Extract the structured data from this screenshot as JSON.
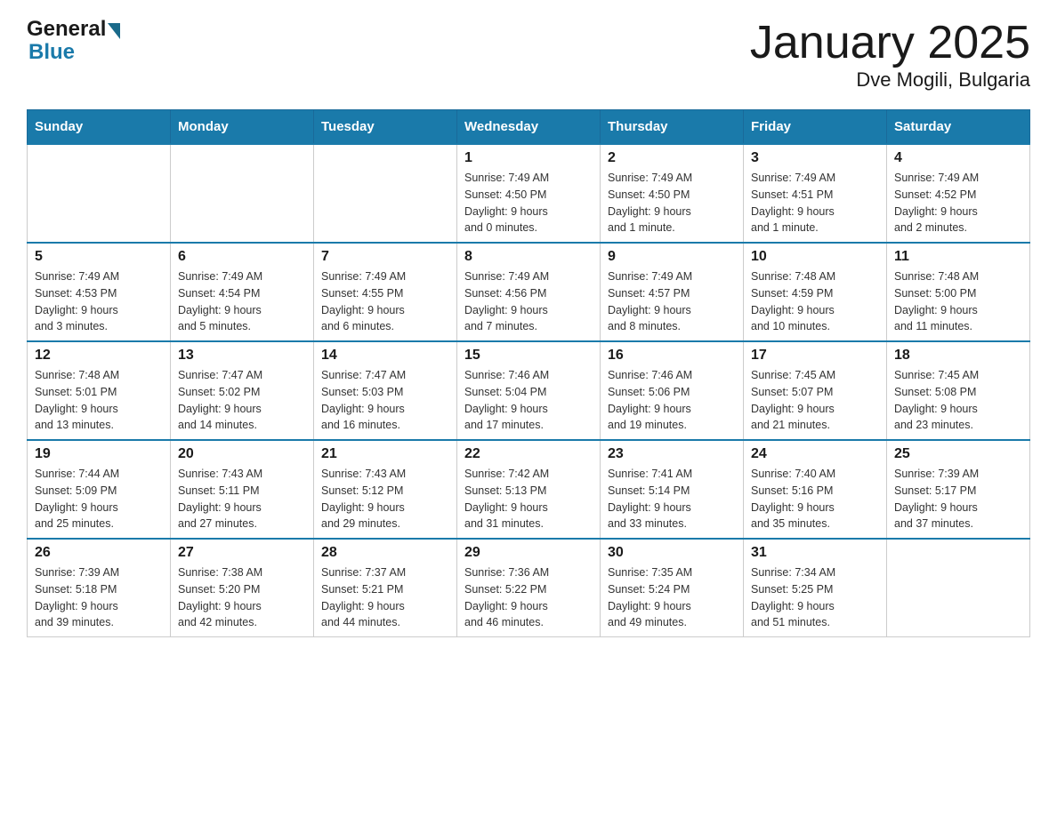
{
  "header": {
    "logo_general": "General",
    "logo_blue": "Blue",
    "main_title": "January 2025",
    "subtitle": "Dve Mogili, Bulgaria"
  },
  "calendar": {
    "days_of_week": [
      "Sunday",
      "Monday",
      "Tuesday",
      "Wednesday",
      "Thursday",
      "Friday",
      "Saturday"
    ],
    "weeks": [
      [
        {
          "day": "",
          "info": ""
        },
        {
          "day": "",
          "info": ""
        },
        {
          "day": "",
          "info": ""
        },
        {
          "day": "1",
          "info": "Sunrise: 7:49 AM\nSunset: 4:50 PM\nDaylight: 9 hours\nand 0 minutes."
        },
        {
          "day": "2",
          "info": "Sunrise: 7:49 AM\nSunset: 4:50 PM\nDaylight: 9 hours\nand 1 minute."
        },
        {
          "day": "3",
          "info": "Sunrise: 7:49 AM\nSunset: 4:51 PM\nDaylight: 9 hours\nand 1 minute."
        },
        {
          "day": "4",
          "info": "Sunrise: 7:49 AM\nSunset: 4:52 PM\nDaylight: 9 hours\nand 2 minutes."
        }
      ],
      [
        {
          "day": "5",
          "info": "Sunrise: 7:49 AM\nSunset: 4:53 PM\nDaylight: 9 hours\nand 3 minutes."
        },
        {
          "day": "6",
          "info": "Sunrise: 7:49 AM\nSunset: 4:54 PM\nDaylight: 9 hours\nand 5 minutes."
        },
        {
          "day": "7",
          "info": "Sunrise: 7:49 AM\nSunset: 4:55 PM\nDaylight: 9 hours\nand 6 minutes."
        },
        {
          "day": "8",
          "info": "Sunrise: 7:49 AM\nSunset: 4:56 PM\nDaylight: 9 hours\nand 7 minutes."
        },
        {
          "day": "9",
          "info": "Sunrise: 7:49 AM\nSunset: 4:57 PM\nDaylight: 9 hours\nand 8 minutes."
        },
        {
          "day": "10",
          "info": "Sunrise: 7:48 AM\nSunset: 4:59 PM\nDaylight: 9 hours\nand 10 minutes."
        },
        {
          "day": "11",
          "info": "Sunrise: 7:48 AM\nSunset: 5:00 PM\nDaylight: 9 hours\nand 11 minutes."
        }
      ],
      [
        {
          "day": "12",
          "info": "Sunrise: 7:48 AM\nSunset: 5:01 PM\nDaylight: 9 hours\nand 13 minutes."
        },
        {
          "day": "13",
          "info": "Sunrise: 7:47 AM\nSunset: 5:02 PM\nDaylight: 9 hours\nand 14 minutes."
        },
        {
          "day": "14",
          "info": "Sunrise: 7:47 AM\nSunset: 5:03 PM\nDaylight: 9 hours\nand 16 minutes."
        },
        {
          "day": "15",
          "info": "Sunrise: 7:46 AM\nSunset: 5:04 PM\nDaylight: 9 hours\nand 17 minutes."
        },
        {
          "day": "16",
          "info": "Sunrise: 7:46 AM\nSunset: 5:06 PM\nDaylight: 9 hours\nand 19 minutes."
        },
        {
          "day": "17",
          "info": "Sunrise: 7:45 AM\nSunset: 5:07 PM\nDaylight: 9 hours\nand 21 minutes."
        },
        {
          "day": "18",
          "info": "Sunrise: 7:45 AM\nSunset: 5:08 PM\nDaylight: 9 hours\nand 23 minutes."
        }
      ],
      [
        {
          "day": "19",
          "info": "Sunrise: 7:44 AM\nSunset: 5:09 PM\nDaylight: 9 hours\nand 25 minutes."
        },
        {
          "day": "20",
          "info": "Sunrise: 7:43 AM\nSunset: 5:11 PM\nDaylight: 9 hours\nand 27 minutes."
        },
        {
          "day": "21",
          "info": "Sunrise: 7:43 AM\nSunset: 5:12 PM\nDaylight: 9 hours\nand 29 minutes."
        },
        {
          "day": "22",
          "info": "Sunrise: 7:42 AM\nSunset: 5:13 PM\nDaylight: 9 hours\nand 31 minutes."
        },
        {
          "day": "23",
          "info": "Sunrise: 7:41 AM\nSunset: 5:14 PM\nDaylight: 9 hours\nand 33 minutes."
        },
        {
          "day": "24",
          "info": "Sunrise: 7:40 AM\nSunset: 5:16 PM\nDaylight: 9 hours\nand 35 minutes."
        },
        {
          "day": "25",
          "info": "Sunrise: 7:39 AM\nSunset: 5:17 PM\nDaylight: 9 hours\nand 37 minutes."
        }
      ],
      [
        {
          "day": "26",
          "info": "Sunrise: 7:39 AM\nSunset: 5:18 PM\nDaylight: 9 hours\nand 39 minutes."
        },
        {
          "day": "27",
          "info": "Sunrise: 7:38 AM\nSunset: 5:20 PM\nDaylight: 9 hours\nand 42 minutes."
        },
        {
          "day": "28",
          "info": "Sunrise: 7:37 AM\nSunset: 5:21 PM\nDaylight: 9 hours\nand 44 minutes."
        },
        {
          "day": "29",
          "info": "Sunrise: 7:36 AM\nSunset: 5:22 PM\nDaylight: 9 hours\nand 46 minutes."
        },
        {
          "day": "30",
          "info": "Sunrise: 7:35 AM\nSunset: 5:24 PM\nDaylight: 9 hours\nand 49 minutes."
        },
        {
          "day": "31",
          "info": "Sunrise: 7:34 AM\nSunset: 5:25 PM\nDaylight: 9 hours\nand 51 minutes."
        },
        {
          "day": "",
          "info": ""
        }
      ]
    ]
  }
}
